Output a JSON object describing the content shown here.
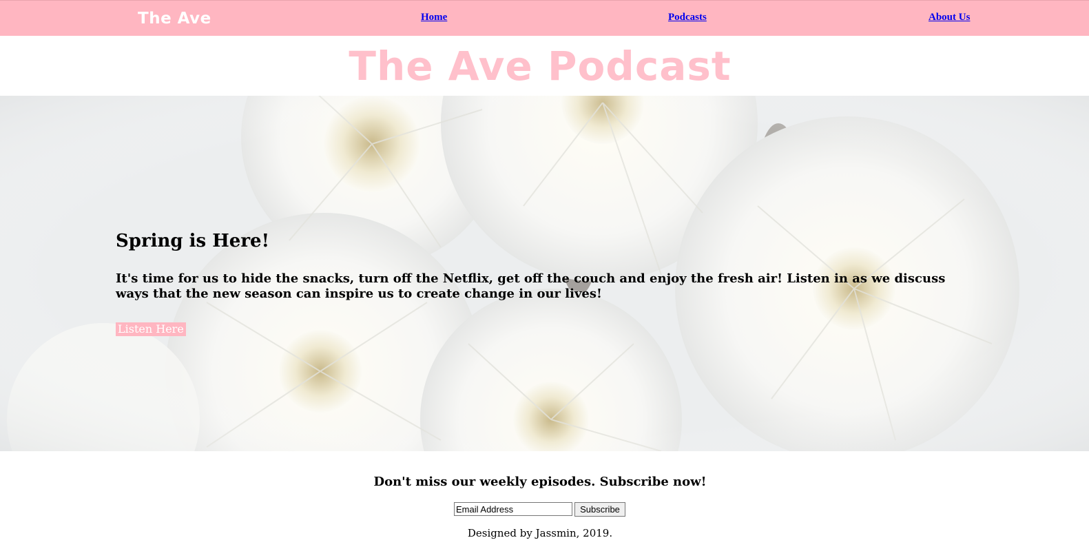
{
  "nav": {
    "brand": "The Ave",
    "links": [
      {
        "label": "Home"
      },
      {
        "label": "Podcasts"
      },
      {
        "label": "About Us"
      }
    ]
  },
  "page_title": "The Ave Podcast",
  "hero": {
    "heading": "Spring is Here!",
    "text": "It's time for us to hide the snacks, turn off the Netflix, get off the couch and enjoy the fresh air! Listen in as we discuss ways that the new season can inspire us to create change in our lives!",
    "button_label": "Listen Here",
    "image": "white-chrysanthemum-flowers"
  },
  "subscribe": {
    "title": "Don't miss our weekly episodes. Subscribe now!",
    "email_value": "Email Address",
    "button_label": "Subscribe"
  },
  "footer": {
    "text": "Designed by Jassmin, 2019."
  },
  "colors": {
    "nav_bg": "#ffb6c1",
    "title": "#ffc0cb",
    "link": "#0000ee",
    "button_bg": "#ffb6c1"
  }
}
